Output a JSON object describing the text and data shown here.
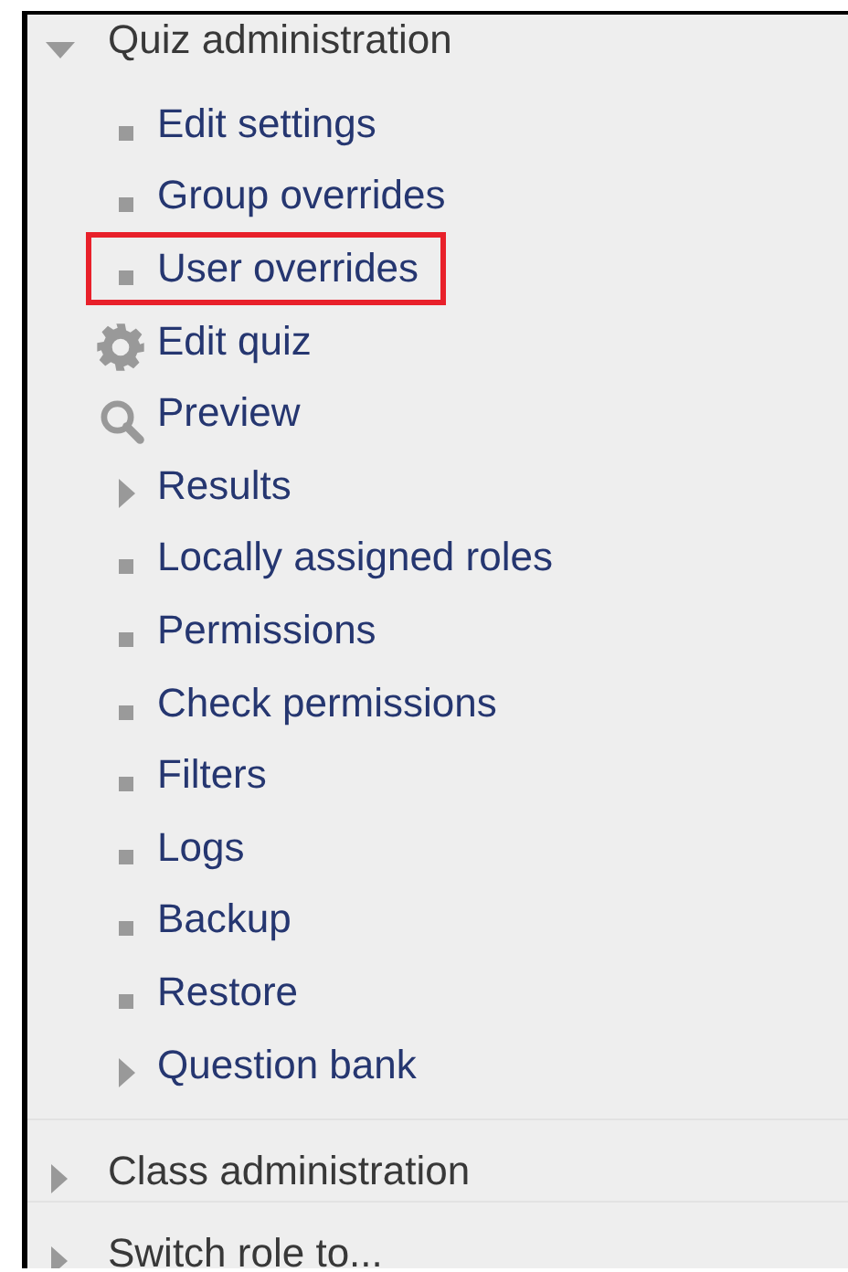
{
  "nav": [
    {
      "label": "Quiz administration",
      "expanded": true,
      "children": [
        {
          "label": "Edit settings",
          "kind": "bullet",
          "highlighted": false
        },
        {
          "label": "Group overrides",
          "kind": "bullet",
          "highlighted": false
        },
        {
          "label": "User overrides",
          "kind": "bullet",
          "highlighted": true
        },
        {
          "label": "Edit quiz",
          "kind": "gear",
          "highlighted": false
        },
        {
          "label": "Preview",
          "kind": "search",
          "highlighted": false
        },
        {
          "label": "Results",
          "kind": "branch",
          "highlighted": false
        },
        {
          "label": "Locally assigned roles",
          "kind": "bullet",
          "highlighted": false
        },
        {
          "label": "Permissions",
          "kind": "bullet",
          "highlighted": false
        },
        {
          "label": "Check permissions",
          "kind": "bullet",
          "highlighted": false
        },
        {
          "label": "Filters",
          "kind": "bullet",
          "highlighted": false
        },
        {
          "label": "Logs",
          "kind": "bullet",
          "highlighted": false
        },
        {
          "label": "Backup",
          "kind": "bullet",
          "highlighted": false
        },
        {
          "label": "Restore",
          "kind": "bullet",
          "highlighted": false
        },
        {
          "label": "Question bank",
          "kind": "branch",
          "highlighted": false
        }
      ]
    },
    {
      "label": "Class administration",
      "expanded": false
    },
    {
      "label": "Switch role to...",
      "expanded": false
    }
  ]
}
